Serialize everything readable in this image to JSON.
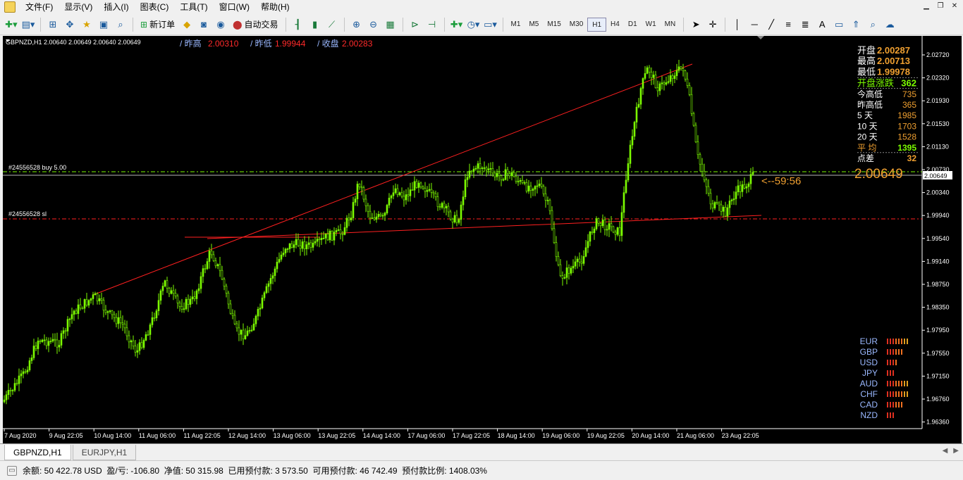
{
  "menu": {
    "items": [
      "文件(F)",
      "显示(V)",
      "插入(I)",
      "图表(C)",
      "工具(T)",
      "窗口(W)",
      "帮助(H)"
    ]
  },
  "toolbar": {
    "new_order_label": "新订单",
    "auto_trade_label": "自动交易",
    "timeframes": [
      "M1",
      "M5",
      "M15",
      "M30",
      "H1",
      "H4",
      "D1",
      "W1",
      "MN"
    ],
    "active_timeframe": "H1"
  },
  "chart": {
    "symbol_header": "GBPNZD,H1  2.00640 2.00649 2.00640 2.00649",
    "yesterday_high_label": "/ 昨高",
    "yesterday_high_value": "2.00310",
    "yesterday_low_label": "/ 昨低",
    "yesterday_low_value": "1.99944",
    "yesterday_close_label": "/ 收盘",
    "yesterday_close_value": "2.00283",
    "order_buy_label": "#24556528 buy 5.00",
    "order_sl_label": "#24556528 sl",
    "current_price": "2.00649",
    "current_price_tag": "2.00649",
    "countdown": "<--59:56",
    "colors": {
      "background": "#000000",
      "candle": "#7cfc00",
      "trendline": "#ff2020",
      "axis_text": "#ffffff",
      "orange": "#f0a030",
      "red_text": "#ff2a2a",
      "buy_line": "#7cfc00",
      "sl_line": "#ff2020"
    },
    "y_axis_labels": [
      "2.02720",
      "2.02320",
      "2.01930",
      "2.01530",
      "2.01130",
      "2.00730",
      "2.00340",
      "1.99940",
      "1.99540",
      "1.99140",
      "1.98750",
      "1.98350",
      "1.97950",
      "1.97550",
      "1.97150",
      "1.96760",
      "1.96360"
    ],
    "x_axis_labels": [
      "7 Aug 2020",
      "9 Aug 22:05",
      "10 Aug 14:00",
      "11 Aug 06:00",
      "11 Aug 22:05",
      "12 Aug 14:00",
      "13 Aug 06:00",
      "13 Aug 22:05",
      "14 Aug 14:00",
      "17 Aug 06:00",
      "17 Aug 22:05",
      "18 Aug 14:00",
      "19 Aug 06:00",
      "19 Aug 22:05",
      "20 Aug 14:00",
      "21 Aug 06:00",
      "23 Aug 22:05"
    ],
    "info_panel": [
      {
        "label": "开盘",
        "value": "2.00287",
        "label_color": "#ffffff",
        "value_color": "#f0a030"
      },
      {
        "label": "最高",
        "value": "2.00713",
        "label_color": "#ffffff",
        "value_color": "#f0a030"
      },
      {
        "label": "最低",
        "value": "1.99978",
        "label_color": "#ffffff",
        "value_color": "#f0a030"
      },
      {
        "label": "开盘涨跌",
        "value": "362",
        "label_color": "#7cfc00",
        "value_color": "#7cfc00"
      },
      {
        "label": "今高低",
        "value": "735",
        "label_color": "#ffffff",
        "value_color": "#f0a030"
      },
      {
        "label": "昨高低",
        "value": "365",
        "label_color": "#ffffff",
        "value_color": "#f0a030"
      },
      {
        "label": "5   天",
        "value": "1985",
        "label_color": "#ffffff",
        "value_color": "#f0a030"
      },
      {
        "label": "10  天",
        "value": "1703",
        "label_color": "#ffffff",
        "value_color": "#f0a030"
      },
      {
        "label": "20  天",
        "value": "1528",
        "label_color": "#ffffff",
        "value_color": "#f0a030"
      },
      {
        "label": "平  均",
        "value": "1395",
        "label_color": "#f0a030",
        "value_color": "#7cfc00"
      },
      {
        "label": "点差",
        "value": "32",
        "label_color": "#ffffff",
        "value_color": "#f0a030"
      }
    ],
    "currency_strength": [
      {
        "code": "EUR",
        "bars": 8
      },
      {
        "code": "GBP",
        "bars": 6
      },
      {
        "code": "USD",
        "bars": 4
      },
      {
        "code": "JPY",
        "bars": 3
      },
      {
        "code": "AUD",
        "bars": 8
      },
      {
        "code": "CHF",
        "bars": 8
      },
      {
        "code": "CAD",
        "bars": 6
      },
      {
        "code": "NZD",
        "bars": 3
      }
    ]
  },
  "tabs": [
    "GBPNZD,H1",
    "EURJPY,H1"
  ],
  "active_tab": "GBPNZD,H1",
  "status": {
    "text": "余额: 50 422.78 USD  盈/亏: -106.80  净值: 50 315.98  已用预付款: 3 573.50  可用预付款: 46 742.49  预付款比例: 1408.03%"
  }
}
